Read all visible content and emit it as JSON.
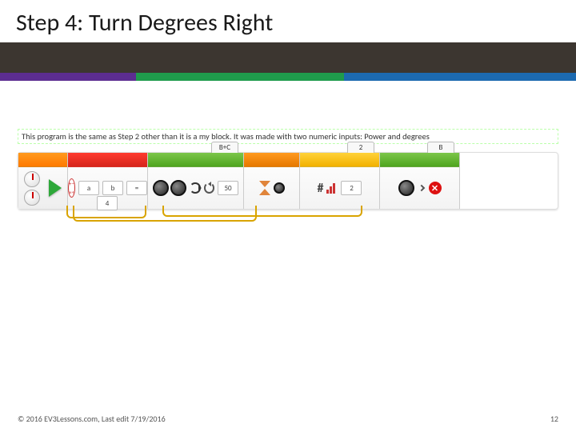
{
  "slide_title": "Step 4: Turn Degrees Right",
  "description": "This program is the same as Step 2 other than it is a my block. It was made with two numeric inputs: Power and degrees",
  "blocks": {
    "math": {
      "a_label": "a",
      "b_label": "b",
      "eq": "=",
      "val": "4"
    },
    "tankA": {
      "port": "B+C",
      "steer": "50"
    },
    "wait": {
      "label": ""
    },
    "sensor": {
      "port": "2",
      "val": "2"
    },
    "tankB": {
      "port": "B"
    }
  },
  "footer_left": "© 2016 EV3Lessons.com, Last edit 7/19/2016",
  "footer_right": "12"
}
